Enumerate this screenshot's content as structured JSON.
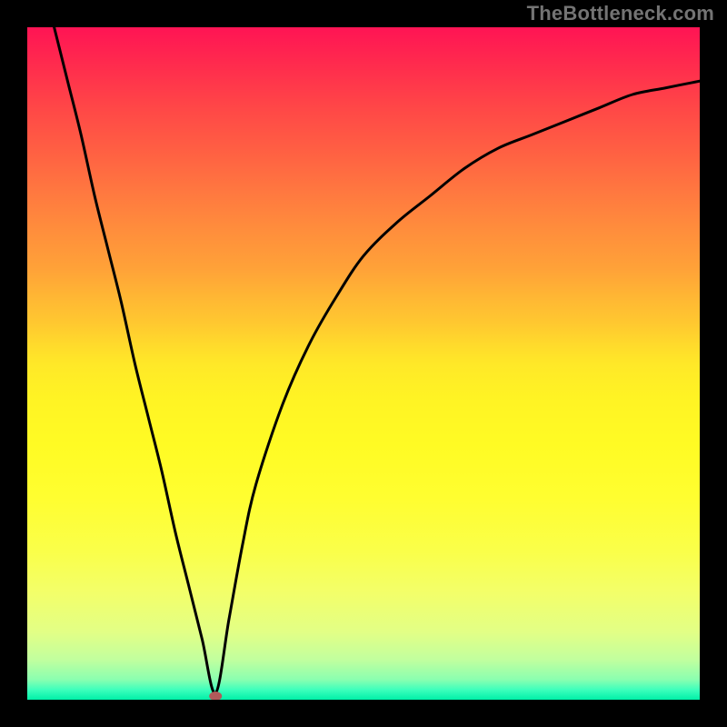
{
  "watermark": "TheBottleneck.com",
  "chart_data": {
    "type": "line",
    "title": "",
    "xlabel": "",
    "ylabel": "",
    "xlim": [
      0,
      1
    ],
    "ylim": [
      0,
      1
    ],
    "grid": false,
    "legend": false,
    "annotations": [],
    "cusp": {
      "pos_x": 0.28,
      "pos_y": 0.0
    },
    "background_gradient": {
      "direction": "vertical",
      "stops": [
        {
          "t": 0.0,
          "color": "#ff1454"
        },
        {
          "t": 0.5,
          "color": "#ffe828"
        },
        {
          "t": 1.0,
          "color": "#00f0a8"
        }
      ]
    },
    "series": [
      {
        "name": "bottleneck-curve",
        "color": "#000000",
        "x": [
          0.04,
          0.06,
          0.08,
          0.1,
          0.12,
          0.14,
          0.16,
          0.18,
          0.2,
          0.22,
          0.24,
          0.26,
          0.28,
          0.3,
          0.32,
          0.34,
          0.38,
          0.42,
          0.46,
          0.5,
          0.55,
          0.6,
          0.65,
          0.7,
          0.75,
          0.8,
          0.85,
          0.9,
          0.95,
          1.0
        ],
        "y": [
          1.0,
          0.92,
          0.84,
          0.75,
          0.67,
          0.59,
          0.5,
          0.42,
          0.34,
          0.25,
          0.17,
          0.09,
          0.01,
          0.12,
          0.23,
          0.32,
          0.44,
          0.53,
          0.6,
          0.66,
          0.71,
          0.75,
          0.79,
          0.82,
          0.84,
          0.86,
          0.88,
          0.9,
          0.91,
          0.92
        ]
      }
    ]
  }
}
